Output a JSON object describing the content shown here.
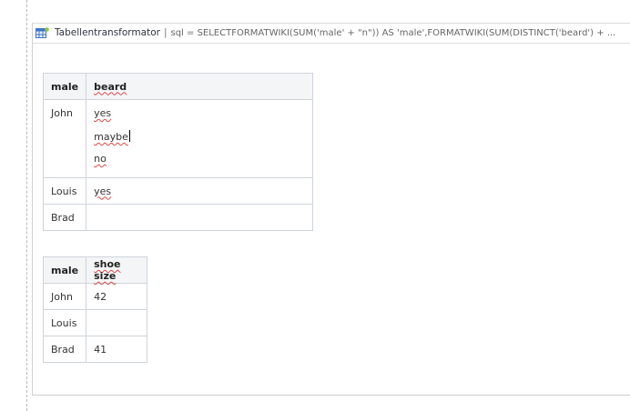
{
  "macro": {
    "title": "Tabellentransformator",
    "separator": "|",
    "params": "sql = SELECTFORMATWIKI(SUM('male' + \"n\")) AS 'male',FORMATWIKI(SUM(DISTINCT('beard') + ...",
    "icon": "table-macro-icon"
  },
  "table1": {
    "headers": [
      "male",
      "beard"
    ],
    "rows": [
      {
        "male": "John",
        "beard": [
          "yes",
          "maybe",
          "no"
        ]
      },
      {
        "male": "Louis",
        "beard": [
          "yes"
        ]
      },
      {
        "male": "Brad",
        "beard": []
      }
    ]
  },
  "table2": {
    "headers": [
      "male",
      "shoe size"
    ],
    "rows": [
      {
        "male": "John",
        "size": "42"
      },
      {
        "male": "Louis",
        "size": ""
      },
      {
        "male": "Brad",
        "size": "41"
      }
    ]
  }
}
